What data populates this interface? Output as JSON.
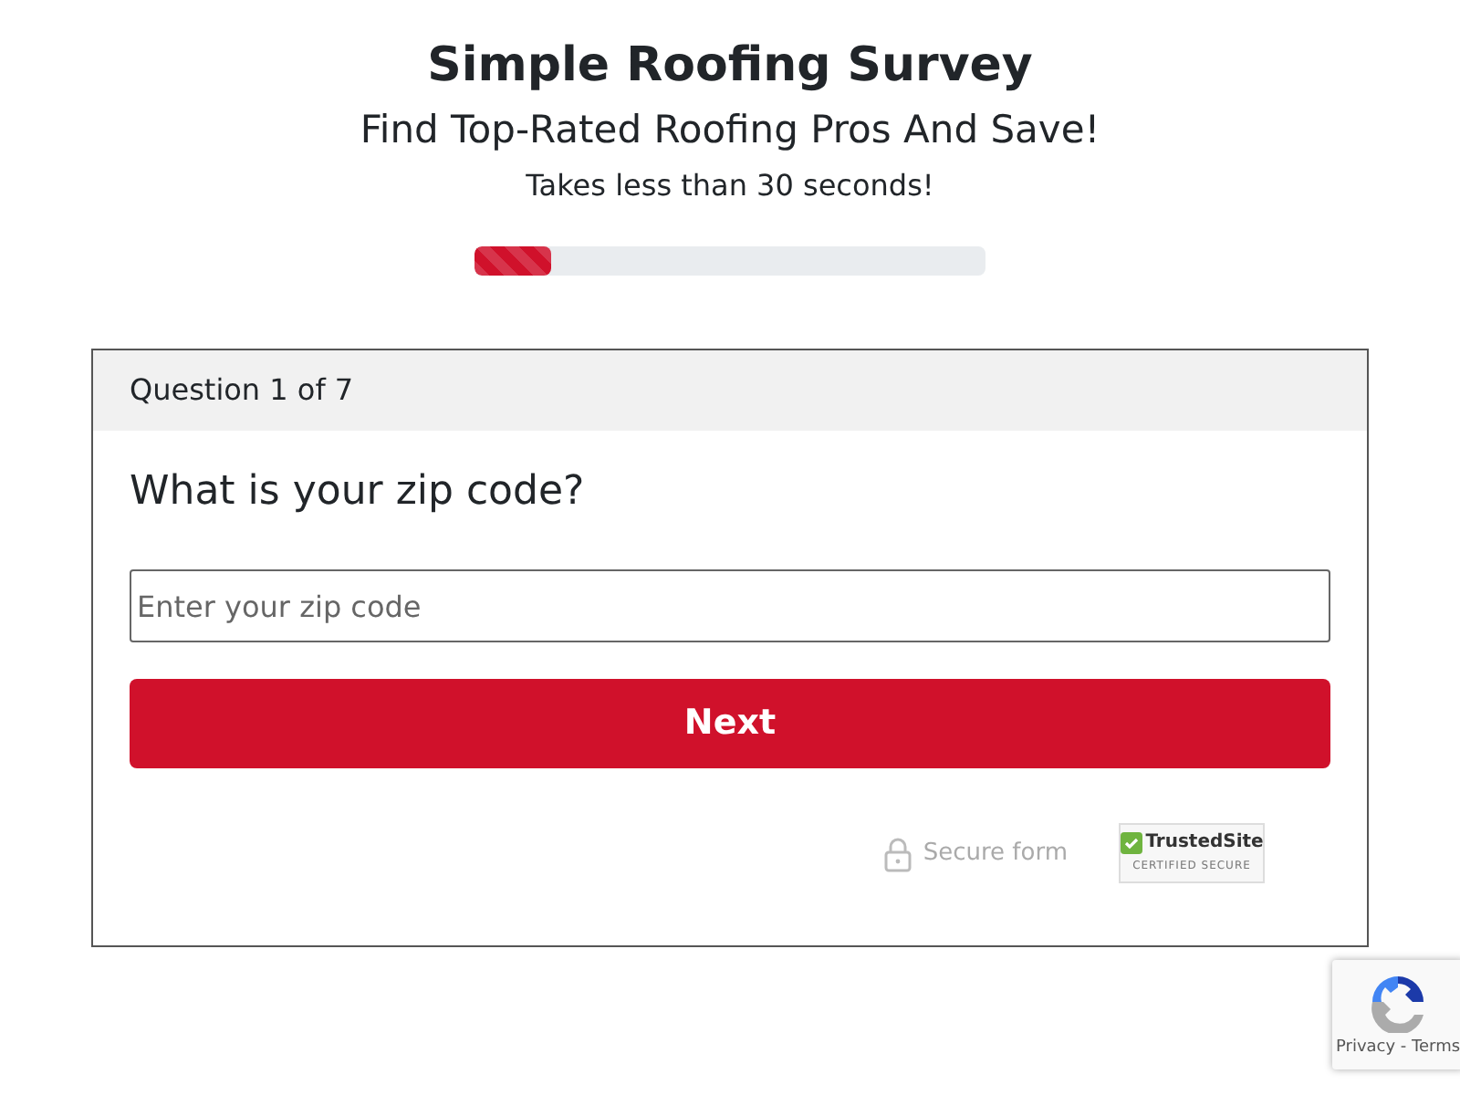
{
  "header": {
    "title": "Simple Roofing Survey",
    "subtitle": "Find Top-Rated Roofing Pros And Save!",
    "tagline": "Takes less than 30 seconds!"
  },
  "progress": {
    "level": 0.15
  },
  "card": {
    "step": "Question 1 of 7",
    "question": "What is your zip code?",
    "field": {
      "placeholder": "Enter your zip code"
    },
    "button": "Next"
  },
  "badges": {
    "secure": "Secure form",
    "trusted": "TrustedSite",
    "trusted_sub": "CERTIFIED SECURE"
  },
  "recaptcha": {
    "links": "Privacy - Terms"
  }
}
